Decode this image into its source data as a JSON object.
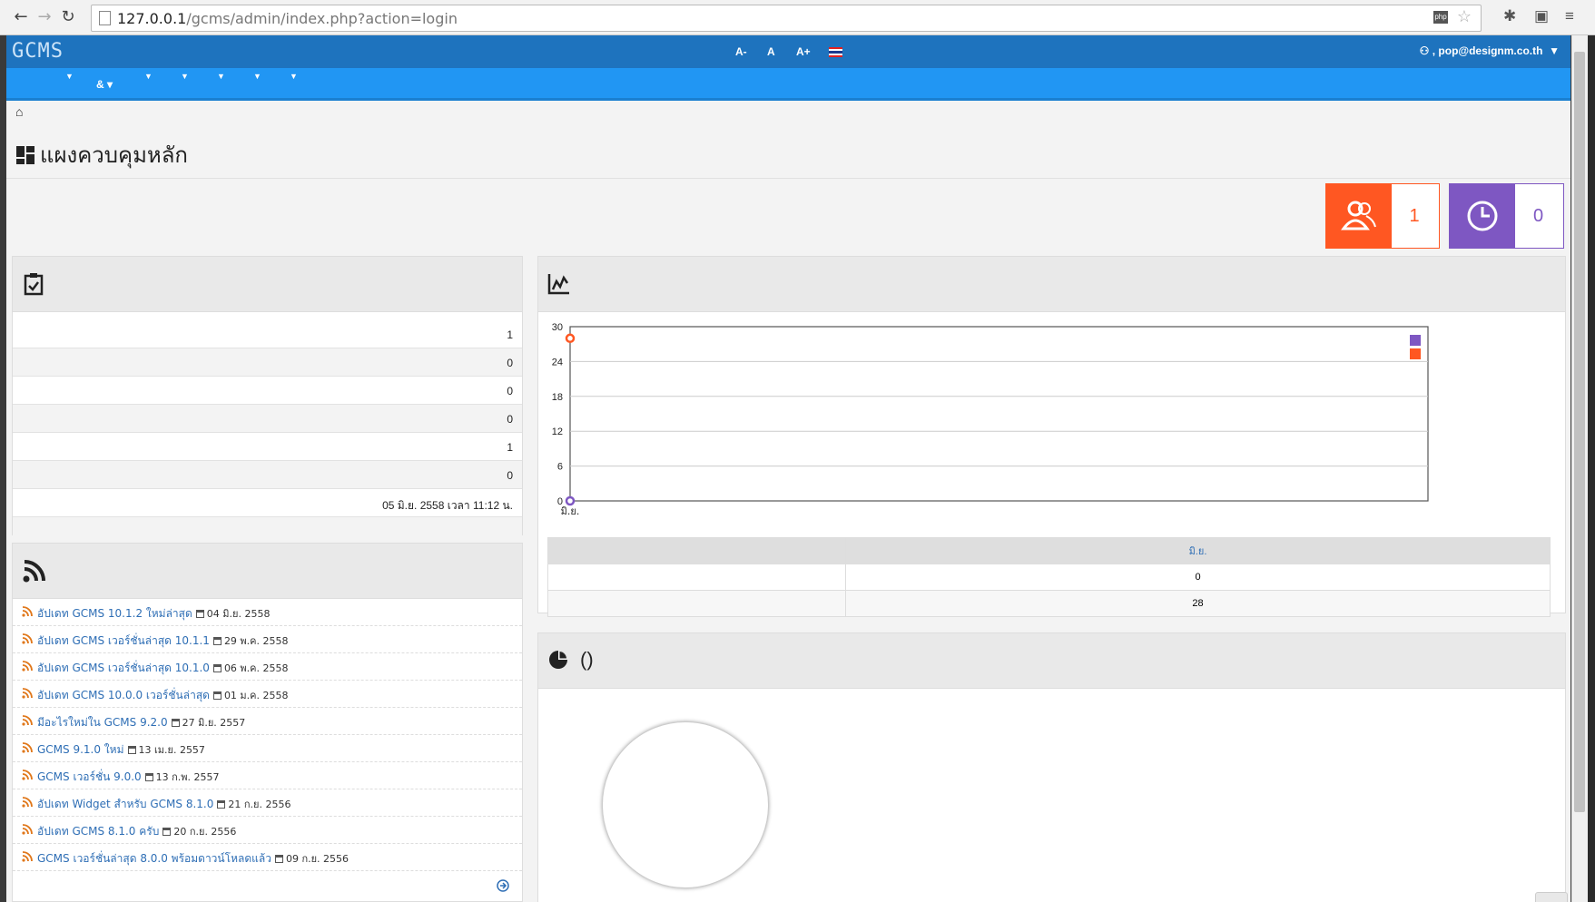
{
  "browser": {
    "url_host": "127.0.0.1",
    "url_path": "/gcms/admin/index.php?action=login",
    "badge": "php"
  },
  "header": {
    "logo": "GCMS",
    "font_controls": [
      "A-",
      "A",
      "A+"
    ],
    "user_label": ", pop@designm.co.th",
    "nav_amp": "&"
  },
  "page": {
    "title": "แผงควบคุมหลัก"
  },
  "cards": [
    {
      "icon": "users-icon",
      "value": "1",
      "color": "#ff5722"
    },
    {
      "icon": "clock-icon",
      "value": "0",
      "color": "#7e57c2"
    }
  ],
  "stats": {
    "rows": [
      "1",
      "0",
      "0",
      "0",
      "1",
      "0",
      "05 มิ.ย. 2558 เวลา 11:12 น.",
      ""
    ]
  },
  "news": {
    "items": [
      {
        "title": "อัปเดท GCMS 10.1.2 ใหม่ล่าสุด",
        "date": "04 มิ.ย. 2558"
      },
      {
        "title": "อัปเดท GCMS เวอร์ชั่นล่าสุด 10.1.1",
        "date": "29 พ.ค. 2558"
      },
      {
        "title": "อัปเดท GCMS เวอร์ชั่นล่าสุด 10.1.0",
        "date": "06 พ.ค. 2558"
      },
      {
        "title": "อัปเดท GCMS 10.0.0 เวอร์ชั่นล่าสุด",
        "date": "01 ม.ค. 2558"
      },
      {
        "title": "มีอะไรใหม่ใน GCMS 9.2.0",
        "date": "27 มิ.ย. 2557"
      },
      {
        "title": "GCMS 9.1.0 ใหม่",
        "date": "13 เม.ย. 2557"
      },
      {
        "title": "GCMS เวอร์ชั่น 9.0.0",
        "date": "13 ก.พ. 2557"
      },
      {
        "title": "อัปเดท Widget สำหรับ GCMS 8.1.0",
        "date": "21 ก.ย. 2556"
      },
      {
        "title": "อัปเดท GCMS 8.1.0 ครับ",
        "date": "20 ก.ย. 2556"
      },
      {
        "title": "GCMS เวอร์ชั่นล่าสุด 8.0.0 พร้อมดาวน์โหลดแล้ว",
        "date": "09 ก.ย. 2556"
      }
    ]
  },
  "visitors": {
    "table_header": "มิ.ย.",
    "table_values": [
      "0",
      "28"
    ]
  },
  "pie_panel": {
    "title": "()"
  },
  "chart_data": {
    "type": "line",
    "x": [
      "มิ.ย."
    ],
    "series": [
      {
        "values": [
          0
        ],
        "color": "#7e57c2"
      },
      {
        "values": [
          28
        ],
        "color": "#ff5722"
      }
    ],
    "yticks": [
      0,
      6,
      12,
      18,
      24,
      30
    ],
    "ylim": [
      0,
      30
    ],
    "grid": true,
    "legend": "top-right"
  }
}
